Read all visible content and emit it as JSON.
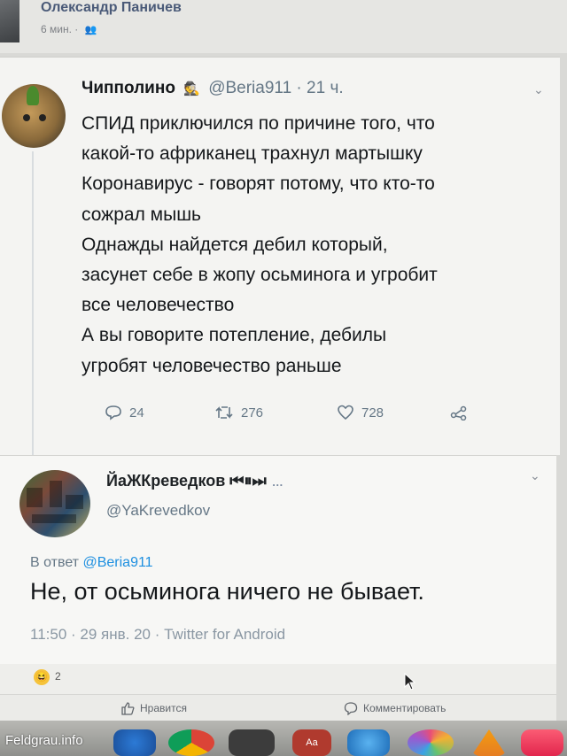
{
  "facebook_post": {
    "author": "Олександр Паничев",
    "time": "6 мин. ·",
    "audience_icon": "friends-icon"
  },
  "tweet": {
    "name": "Чипполино",
    "handle": "@Beria911",
    "time": "· 21 ч.",
    "lines": [
      "СПИД приключился  по причине того, что",
      "какой-то африканец трахнул мартышку",
      "Коронавирус - говорят потому, что кто-то",
      "сожрал мышь",
      "Однажды найдется дебил который,",
      "засунет себе в жопу осьминога и угробит",
      "все человечество",
      "А вы говорите потепление, дебилы",
      "угробят человечество раньше"
    ],
    "replies": "24",
    "retweets": "276",
    "likes": "728"
  },
  "reply_tweet": {
    "name": "ЙаЖКреведков ⏮⏸⏭",
    "name_suffix": "…",
    "handle": "@YaKrevedkov",
    "reply_to_label": "В ответ",
    "reply_to_handle": "@Beria911",
    "text": "Не, от осьминога ничего не бывает.",
    "meta": "11:50 · 29 янв. 20 · Twitter for Android"
  },
  "reactions": {
    "emoji": "😆",
    "count": "2"
  },
  "actions": {
    "like": "Нравится",
    "comment": "Комментировать"
  },
  "watermark": "Feldgrau.info",
  "colors": {
    "twitter_blue": "#1d8fe0",
    "fb_name": "#4a5a78",
    "muted": "#657786"
  }
}
